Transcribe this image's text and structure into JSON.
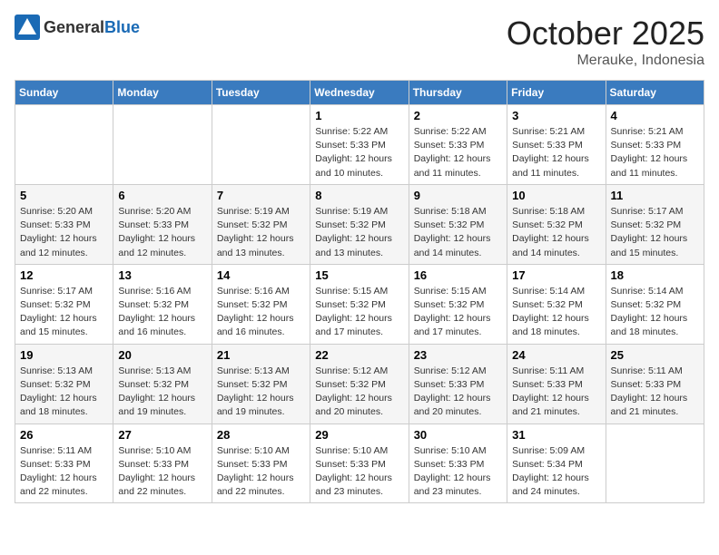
{
  "header": {
    "logo_general": "General",
    "logo_blue": "Blue",
    "month_title": "October 2025",
    "location": "Merauke, Indonesia"
  },
  "weekdays": [
    "Sunday",
    "Monday",
    "Tuesday",
    "Wednesday",
    "Thursday",
    "Friday",
    "Saturday"
  ],
  "weeks": [
    [
      {
        "day": "",
        "info": ""
      },
      {
        "day": "",
        "info": ""
      },
      {
        "day": "",
        "info": ""
      },
      {
        "day": "1",
        "info": "Sunrise: 5:22 AM\nSunset: 5:33 PM\nDaylight: 12 hours\nand 10 minutes."
      },
      {
        "day": "2",
        "info": "Sunrise: 5:22 AM\nSunset: 5:33 PM\nDaylight: 12 hours\nand 11 minutes."
      },
      {
        "day": "3",
        "info": "Sunrise: 5:21 AM\nSunset: 5:33 PM\nDaylight: 12 hours\nand 11 minutes."
      },
      {
        "day": "4",
        "info": "Sunrise: 5:21 AM\nSunset: 5:33 PM\nDaylight: 12 hours\nand 11 minutes."
      }
    ],
    [
      {
        "day": "5",
        "info": "Sunrise: 5:20 AM\nSunset: 5:33 PM\nDaylight: 12 hours\nand 12 minutes."
      },
      {
        "day": "6",
        "info": "Sunrise: 5:20 AM\nSunset: 5:33 PM\nDaylight: 12 hours\nand 12 minutes."
      },
      {
        "day": "7",
        "info": "Sunrise: 5:19 AM\nSunset: 5:32 PM\nDaylight: 12 hours\nand 13 minutes."
      },
      {
        "day": "8",
        "info": "Sunrise: 5:19 AM\nSunset: 5:32 PM\nDaylight: 12 hours\nand 13 minutes."
      },
      {
        "day": "9",
        "info": "Sunrise: 5:18 AM\nSunset: 5:32 PM\nDaylight: 12 hours\nand 14 minutes."
      },
      {
        "day": "10",
        "info": "Sunrise: 5:18 AM\nSunset: 5:32 PM\nDaylight: 12 hours\nand 14 minutes."
      },
      {
        "day": "11",
        "info": "Sunrise: 5:17 AM\nSunset: 5:32 PM\nDaylight: 12 hours\nand 15 minutes."
      }
    ],
    [
      {
        "day": "12",
        "info": "Sunrise: 5:17 AM\nSunset: 5:32 PM\nDaylight: 12 hours\nand 15 minutes."
      },
      {
        "day": "13",
        "info": "Sunrise: 5:16 AM\nSunset: 5:32 PM\nDaylight: 12 hours\nand 16 minutes."
      },
      {
        "day": "14",
        "info": "Sunrise: 5:16 AM\nSunset: 5:32 PM\nDaylight: 12 hours\nand 16 minutes."
      },
      {
        "day": "15",
        "info": "Sunrise: 5:15 AM\nSunset: 5:32 PM\nDaylight: 12 hours\nand 17 minutes."
      },
      {
        "day": "16",
        "info": "Sunrise: 5:15 AM\nSunset: 5:32 PM\nDaylight: 12 hours\nand 17 minutes."
      },
      {
        "day": "17",
        "info": "Sunrise: 5:14 AM\nSunset: 5:32 PM\nDaylight: 12 hours\nand 18 minutes."
      },
      {
        "day": "18",
        "info": "Sunrise: 5:14 AM\nSunset: 5:32 PM\nDaylight: 12 hours\nand 18 minutes."
      }
    ],
    [
      {
        "day": "19",
        "info": "Sunrise: 5:13 AM\nSunset: 5:32 PM\nDaylight: 12 hours\nand 18 minutes."
      },
      {
        "day": "20",
        "info": "Sunrise: 5:13 AM\nSunset: 5:32 PM\nDaylight: 12 hours\nand 19 minutes."
      },
      {
        "day": "21",
        "info": "Sunrise: 5:13 AM\nSunset: 5:32 PM\nDaylight: 12 hours\nand 19 minutes."
      },
      {
        "day": "22",
        "info": "Sunrise: 5:12 AM\nSunset: 5:32 PM\nDaylight: 12 hours\nand 20 minutes."
      },
      {
        "day": "23",
        "info": "Sunrise: 5:12 AM\nSunset: 5:33 PM\nDaylight: 12 hours\nand 20 minutes."
      },
      {
        "day": "24",
        "info": "Sunrise: 5:11 AM\nSunset: 5:33 PM\nDaylight: 12 hours\nand 21 minutes."
      },
      {
        "day": "25",
        "info": "Sunrise: 5:11 AM\nSunset: 5:33 PM\nDaylight: 12 hours\nand 21 minutes."
      }
    ],
    [
      {
        "day": "26",
        "info": "Sunrise: 5:11 AM\nSunset: 5:33 PM\nDaylight: 12 hours\nand 22 minutes."
      },
      {
        "day": "27",
        "info": "Sunrise: 5:10 AM\nSunset: 5:33 PM\nDaylight: 12 hours\nand 22 minutes."
      },
      {
        "day": "28",
        "info": "Sunrise: 5:10 AM\nSunset: 5:33 PM\nDaylight: 12 hours\nand 22 minutes."
      },
      {
        "day": "29",
        "info": "Sunrise: 5:10 AM\nSunset: 5:33 PM\nDaylight: 12 hours\nand 23 minutes."
      },
      {
        "day": "30",
        "info": "Sunrise: 5:10 AM\nSunset: 5:33 PM\nDaylight: 12 hours\nand 23 minutes."
      },
      {
        "day": "31",
        "info": "Sunrise: 5:09 AM\nSunset: 5:34 PM\nDaylight: 12 hours\nand 24 minutes."
      },
      {
        "day": "",
        "info": ""
      }
    ]
  ]
}
